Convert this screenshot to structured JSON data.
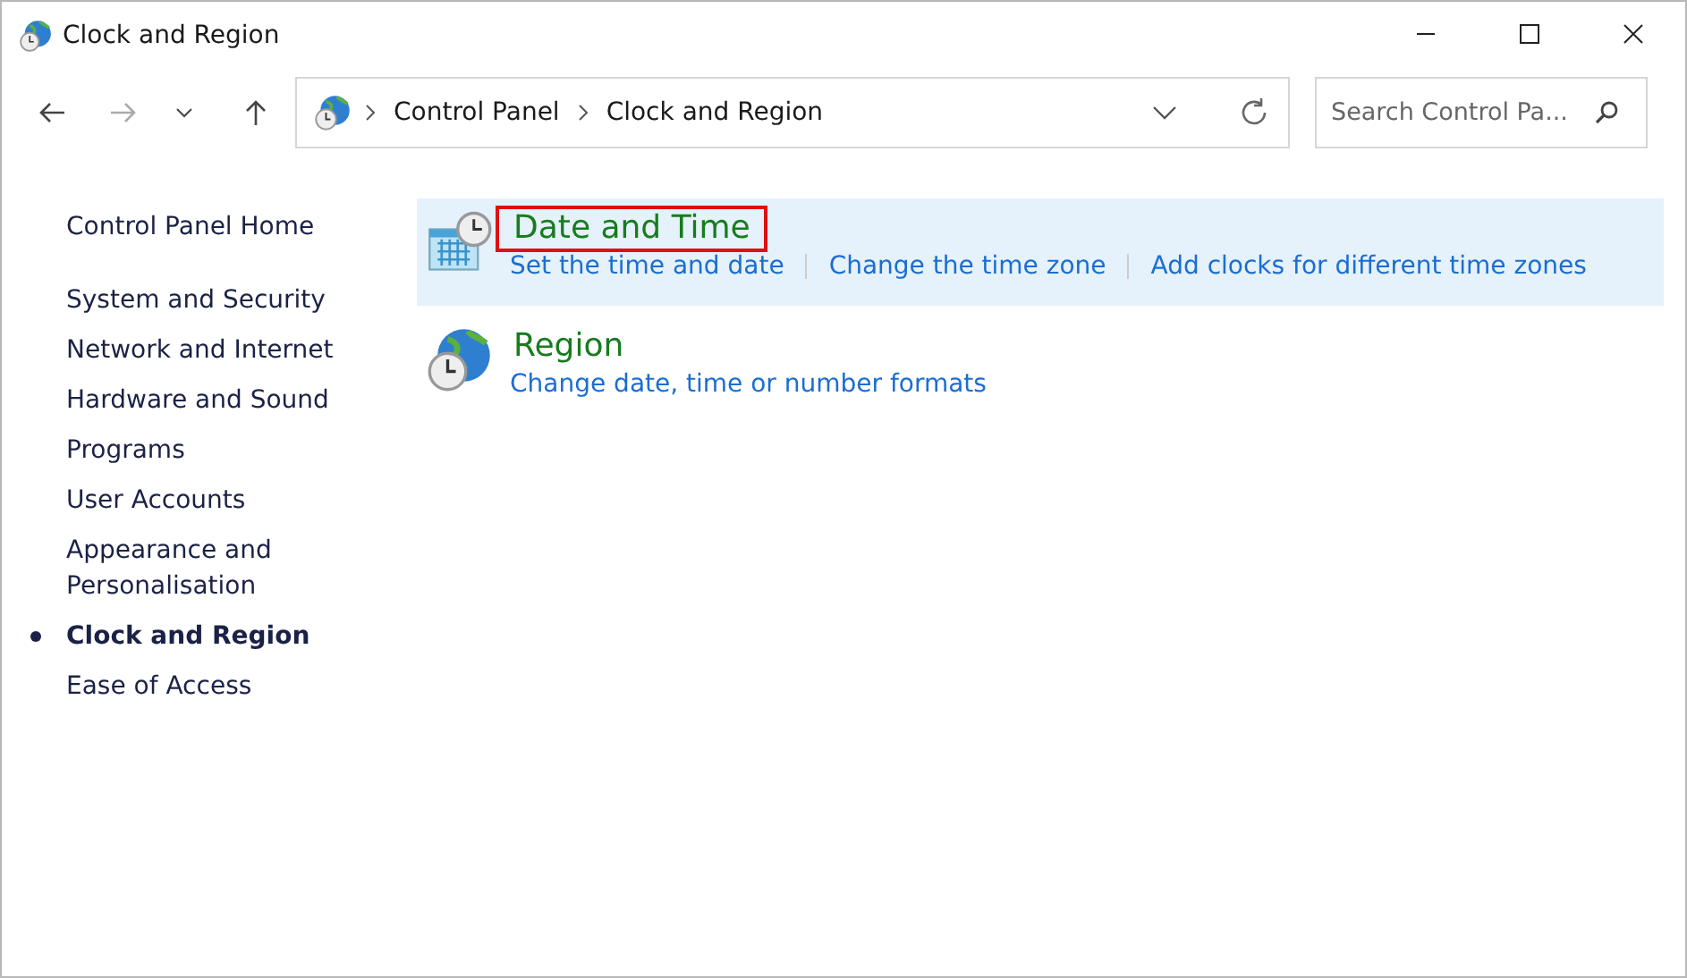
{
  "window": {
    "title": "Clock and Region"
  },
  "address_bar": {
    "breadcrumbs": [
      "Control Panel",
      "Clock and Region"
    ]
  },
  "search": {
    "placeholder": "Search Control Pa..."
  },
  "sidebar": {
    "home": "Control Panel Home",
    "items": [
      {
        "label": "System and Security",
        "selected": false
      },
      {
        "label": "Network and Internet",
        "selected": false
      },
      {
        "label": "Hardware and Sound",
        "selected": false
      },
      {
        "label": "Programs",
        "selected": false
      },
      {
        "label": "User Accounts",
        "selected": false
      },
      {
        "label": "Appearance and Personalisation",
        "selected": false
      },
      {
        "label": "Clock and Region",
        "selected": true
      },
      {
        "label": "Ease of Access",
        "selected": false
      }
    ]
  },
  "categories": [
    {
      "kind": "calendar",
      "title": "Date and Time",
      "selected": true,
      "highlighted": true,
      "links": [
        "Set the time and date",
        "Change the time zone",
        "Add clocks for different time zones"
      ]
    },
    {
      "kind": "globe",
      "title": "Region",
      "selected": false,
      "highlighted": false,
      "links": [
        "Change date, time or number formats"
      ]
    }
  ]
}
